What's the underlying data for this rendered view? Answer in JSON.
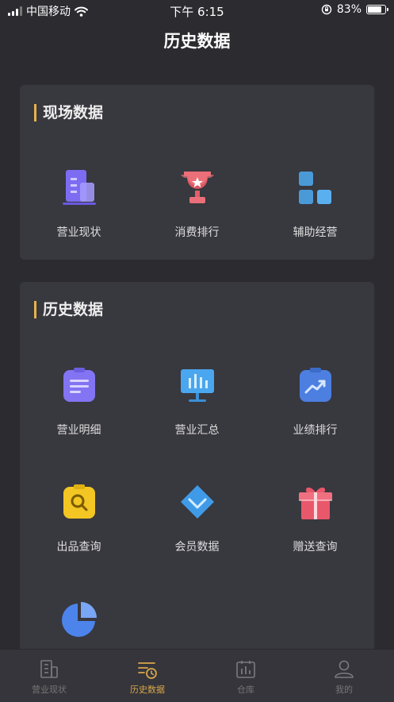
{
  "status_bar": {
    "carrier": "中国移动",
    "time": "下午 6:15",
    "battery": "83%"
  },
  "page": {
    "title": "历史数据"
  },
  "current_section": {
    "title": "现场数据",
    "items": [
      {
        "label": "营业现状",
        "icon": "building-icon"
      },
      {
        "label": "消费排行",
        "icon": "trophy-icon"
      },
      {
        "label": "辅助经营",
        "icon": "blocks-icon"
      }
    ]
  },
  "history_section": {
    "title": "历史数据",
    "items": [
      {
        "label": "营业明细",
        "icon": "clipboard-list-icon"
      },
      {
        "label": "营业汇总",
        "icon": "board-chart-icon"
      },
      {
        "label": "业绩排行",
        "icon": "clipboard-trend-icon"
      },
      {
        "label": "出品查询",
        "icon": "clipboard-search-icon"
      },
      {
        "label": "会员数据",
        "icon": "diamond-icon"
      },
      {
        "label": "赠送查询",
        "icon": "gift-icon"
      },
      {
        "label": "",
        "icon": "pie-chart-icon"
      }
    ]
  },
  "tabbar": {
    "items": [
      {
        "label": "营业现状",
        "icon": "building-icon",
        "active": false
      },
      {
        "label": "历史数据",
        "icon": "history-list-icon",
        "active": true
      },
      {
        "label": "仓库",
        "icon": "warehouse-chart-icon",
        "active": false
      },
      {
        "label": "我的",
        "icon": "user-icon",
        "active": false
      }
    ]
  }
}
